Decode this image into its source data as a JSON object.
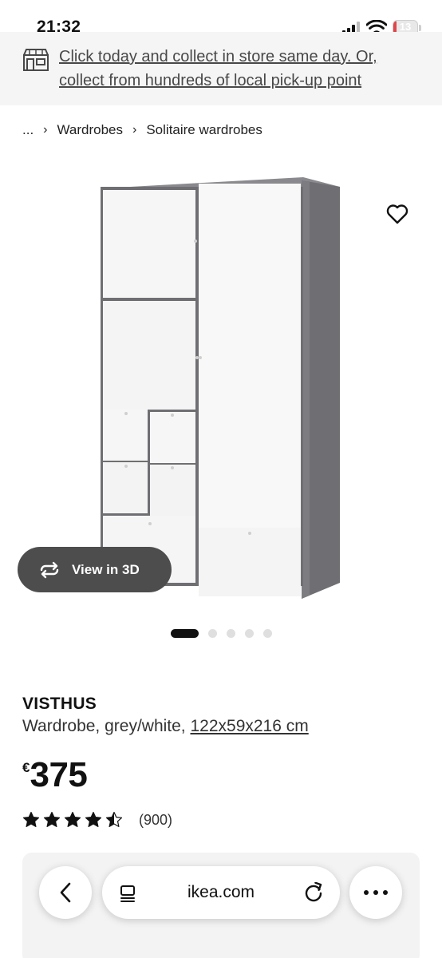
{
  "status_bar": {
    "time": "21:32",
    "battery_level": "13",
    "battery_fraction": 0.13,
    "battery_color": "#e0454b"
  },
  "promo": {
    "icon": "store-icon",
    "text": "Click today and collect in store same day. Or, collect from hundreds of local pick-up point"
  },
  "breadcrumb": {
    "ellipsis": "...",
    "items": [
      "Wardrobes",
      "Solitaire wardrobes"
    ]
  },
  "gallery": {
    "favourite_icon": "heart-icon",
    "view_3d_label": "View in 3D",
    "image_count": 5,
    "active_image": 1
  },
  "product": {
    "name": "VISTHUS",
    "description": "Wardrobe, grey/white,",
    "dimensions": "122x59x216 cm",
    "currency": "€",
    "price": "375",
    "rating_value": 4.5,
    "rating_count": "(900)"
  },
  "browser": {
    "url": "ikea.com",
    "back_icon": "chevron-left-icon",
    "reader_icon": "reader-icon",
    "reload_icon": "reload-icon",
    "more_icon": "more-icon"
  }
}
